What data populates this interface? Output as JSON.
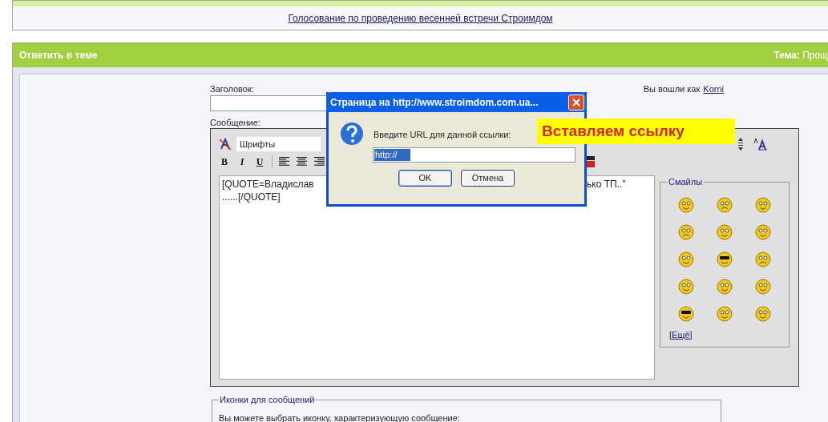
{
  "notice_panel": {
    "link": "Голосование по проведению весенней встречи Строимдом"
  },
  "reply_panel": {
    "title": "Ответить в теме",
    "topic_label": "Тема:",
    "topic_value": "Прощ"
  },
  "form": {
    "subject_label": "Заголовок:",
    "logged_in_text": "Вы вошли как",
    "user_link": "Korni",
    "message_label": "Сообщение:",
    "font_select": "Шрифты",
    "format_buttons": [
      "B",
      "I",
      "U"
    ],
    "message_lines": [
      {
        "left": "[QUOTE=Владислав",
        "right": "ько ТП..\""
      },
      {
        "left": "......[/QUOTE]"
      }
    ],
    "smileys_legend": "Смайлы",
    "smileys_more": "[Ещё]",
    "icons_legend": "Иконки для сообщений",
    "icons_hint": "Вы можете выбрать иконку, характеризующую сообщение:"
  },
  "dialog": {
    "title": "Страница на http://www.stroimdom.com.ua...",
    "prompt": "Введите URL для данной ссылки:",
    "value": "http://",
    "buttons": [
      "OK",
      "Отмена"
    ]
  },
  "annotation": "Вставляем ссылку"
}
